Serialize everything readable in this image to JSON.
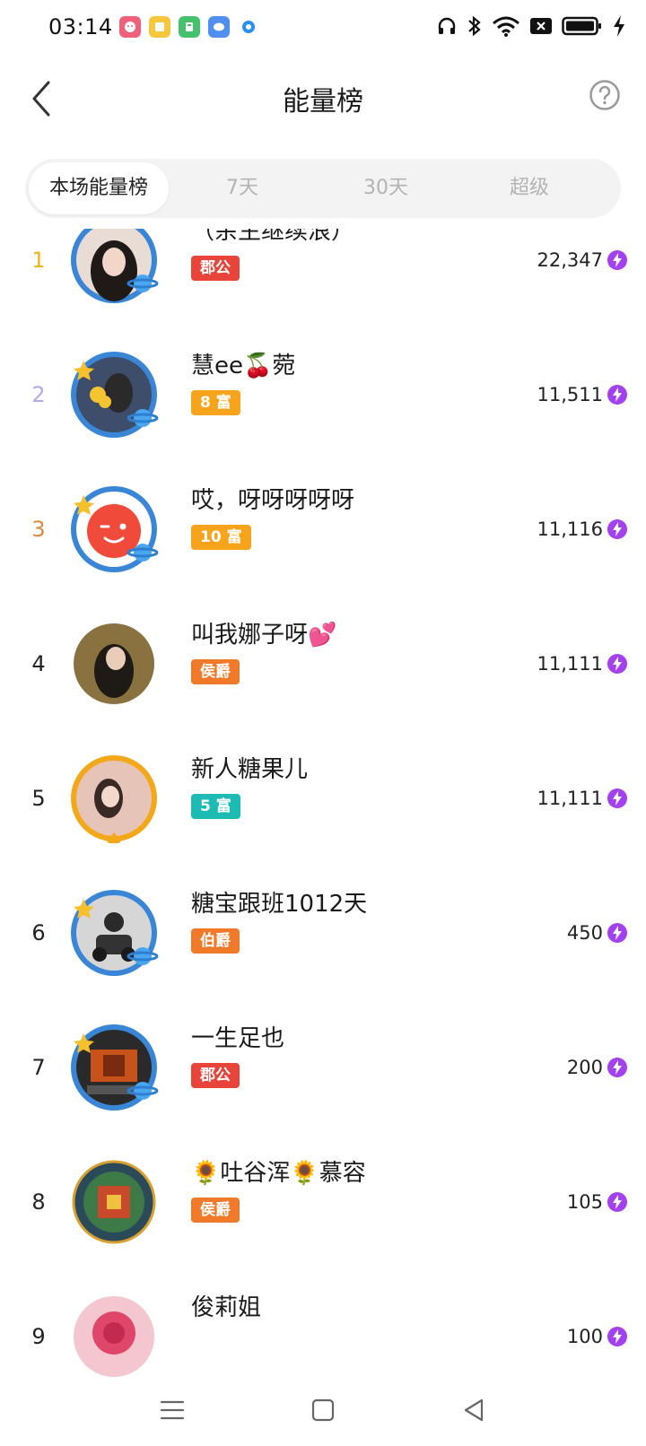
{
  "status": {
    "time": "03:14"
  },
  "header": {
    "title": "能量榜"
  },
  "tabs": [
    {
      "label": "本场能量榜",
      "active": true
    },
    {
      "label": "7天",
      "active": false
    },
    {
      "label": "30天",
      "active": false
    },
    {
      "label": "超级",
      "active": false
    }
  ],
  "rows": [
    {
      "rank": "1",
      "name": "（余生继续浪）",
      "badge": "郡公",
      "score": "22,347"
    },
    {
      "rank": "2",
      "name": "慧ee🍒菀",
      "badge": "8 富",
      "score": "11,511"
    },
    {
      "rank": "3",
      "name": "哎，呀呀呀呀呀",
      "badge": "10 富",
      "score": "11,116"
    },
    {
      "rank": "4",
      "name": "叫我娜子呀💕",
      "badge": "侯爵",
      "score": "11,111"
    },
    {
      "rank": "5",
      "name": "新人糖果儿",
      "badge": "5 富",
      "score": "11,111"
    },
    {
      "rank": "6",
      "name": "糖宝跟班1012天",
      "badge": "伯爵",
      "score": "450"
    },
    {
      "rank": "7",
      "name": "一生足也",
      "badge": "郡公",
      "score": "200"
    },
    {
      "rank": "8",
      "name": "🌻吐谷浑🌻慕容",
      "badge": "侯爵",
      "score": "105"
    },
    {
      "rank": "9",
      "name": "俊莉姐",
      "badge": "",
      "score": "100"
    }
  ],
  "colors": {
    "rank1": "#f0b31c",
    "rank2": "#b6a6ea",
    "rank3": "#d98a3a",
    "rank_default": "#222222",
    "energy_icon": "#a340f0",
    "badge_red": "#e8443a",
    "badge_orange": "#f8a31c",
    "badge_teal": "#1cbcb5"
  },
  "icons": [
    "chevron-left-icon",
    "question-circle-icon",
    "energy-bolt-icon"
  ]
}
